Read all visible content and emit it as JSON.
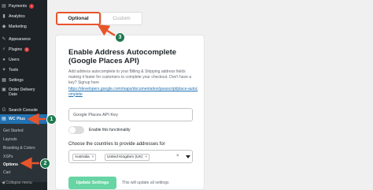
{
  "sidebar": {
    "items": [
      {
        "label": "Payments",
        "icon": "payments-icon",
        "badge": "1"
      },
      {
        "label": "Analytics",
        "icon": "analytics-icon"
      },
      {
        "label": "Marketing",
        "icon": "marketing-icon"
      },
      {
        "label": "Appearance",
        "icon": "appearance-icon"
      },
      {
        "label": "Plugins",
        "icon": "plugins-icon",
        "badge": "5"
      },
      {
        "label": "Users",
        "icon": "users-icon"
      },
      {
        "label": "Tools",
        "icon": "tools-icon"
      },
      {
        "label": "Settings",
        "icon": "settings-icon"
      },
      {
        "label": "Order Delivery",
        "label2": "Date",
        "icon": "order-delivery-icon"
      },
      {
        "label": "Search Console",
        "icon": "search-console-icon"
      },
      {
        "label": "WC Plus",
        "icon": "wc-plus-icon"
      }
    ],
    "submenu": [
      "Get Started",
      "Layouts",
      "Branding & Colors",
      "XSPs",
      "Options",
      "Cart"
    ],
    "collapse_label": "Collapse menu"
  },
  "callouts": [
    "1",
    "2",
    "3"
  ],
  "tabs": {
    "optional": "Optional",
    "custom": "Custom"
  },
  "card": {
    "title": "Enable Address Autocomplete (Google Places API)",
    "description": "Add address autocomplete to your Billing & Shipping address fields making it faster for customers to complete your checkout. Don't have a key? Signup here",
    "link": "https://developers.google.com/maps/documentation/javascript/place-autocomplete",
    "api_placeholder": "Google Places API Key",
    "toggle_label": "Enable this functionality",
    "toggle_on": false,
    "countries_label": "Choose the countries to provide addresses for",
    "countries": [
      "Australia",
      "United Kingdom (UK)"
    ],
    "chip_remove": "×",
    "clear_all": "×",
    "update_button": "Update Settings",
    "update_note": "This will update all settings"
  },
  "colors": {
    "accent": "#e8552b",
    "callout": "#1e7a4f",
    "button": "#67d4a3",
    "sidebar": "#1d2327",
    "active": "#2271b1"
  }
}
